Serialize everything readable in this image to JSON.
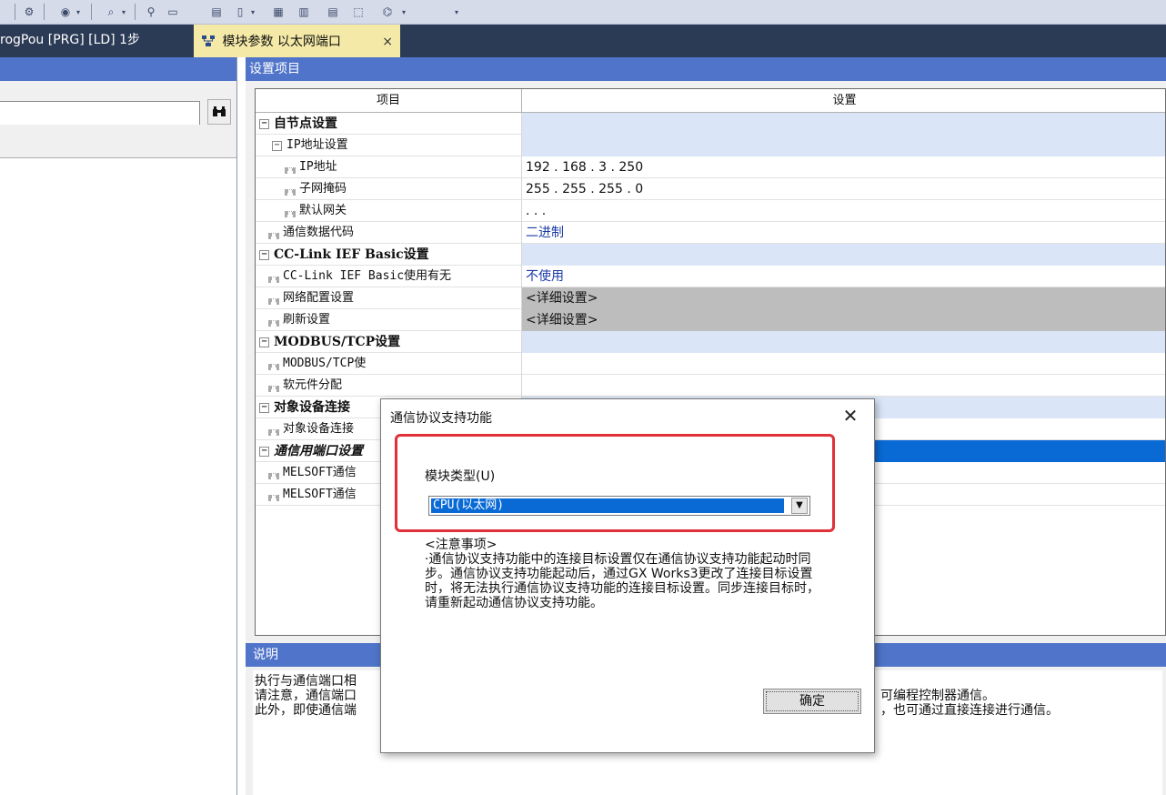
{
  "tabs": {
    "inactive_label": "rogPou [PRG] [LD] 1步",
    "active_label": "模块参数 以太网端口",
    "close_glyph": "×"
  },
  "toolbar": {
    "icons": [
      "wrench-icon",
      "eye-icon",
      "find-icon",
      "zoom-icon",
      "layout-icon",
      "page-icon",
      "grid-icon",
      "compare-icon"
    ]
  },
  "left": {
    "find_glyph": "🔍"
  },
  "settings": {
    "section_title": "设置项目",
    "col_item": "项目",
    "col_setting": "设置",
    "rows": [
      {
        "label": "自节点设置",
        "value": "",
        "type": "sect"
      },
      {
        "label": "IP地址设置",
        "value": "",
        "type": "sub"
      },
      {
        "label": "IP地址",
        "value": "192 . 168 .    3 . 250",
        "type": "leaf"
      },
      {
        "label": "子网掩码",
        "value": "255 . 255 . 255 .    0",
        "type": "leaf"
      },
      {
        "label": "默认网关",
        "value": "      .       .       .",
        "type": "leaf"
      },
      {
        "label": "通信数据代码",
        "value": "二进制",
        "type": "leaf1"
      },
      {
        "label": "CC-Link IEF Basic设置",
        "value": "",
        "type": "sect"
      },
      {
        "label": "CC-Link IEF Basic使用有无",
        "value": "不使用",
        "type": "leaf1"
      },
      {
        "label": "网络配置设置",
        "value": "<详细设置>",
        "type": "leaf1g"
      },
      {
        "label": "刷新设置",
        "value": "<详细设置>",
        "type": "leaf1g"
      },
      {
        "label": "MODBUS/TCP设置",
        "value": "",
        "type": "sect"
      },
      {
        "label": "MODBUS/TCP使",
        "value": "",
        "type": "leaf1"
      },
      {
        "label": "软元件分配",
        "value": "",
        "type": "leaf1"
      },
      {
        "label": "对象设备连接",
        "value": "",
        "type": "sect"
      },
      {
        "label": "对象设备连接",
        "value": "",
        "type": "leaf1"
      },
      {
        "label": "通信用端口设置",
        "value": "",
        "type": "sectsel"
      },
      {
        "label": "MELSOFT通信",
        "value": "",
        "type": "leaf1"
      },
      {
        "label": "MELSOFT通信",
        "value": "",
        "type": "leaf1"
      }
    ]
  },
  "description": {
    "title": "说明",
    "lines": [
      "执行与通信端口相",
      "请注意，通信端口",
      "此外，即使通信端"
    ],
    "right_lines": [
      "可编程控制器通信。",
      "，也可通过直接连接进行通信。"
    ]
  },
  "dialog": {
    "title": "通信协议支持功能",
    "close_glyph": "✕",
    "field_label": "模块类型(U)",
    "combo_value": "CPU(以太网)",
    "notes_title": "<注意事项>",
    "notes_body": "·通信协议支持功能中的连接目标设置仅在通信协议支持功能起动时同步。通信协议支持功能起动后，通过GX Works3更改了连接目标设置时，将无法执行通信协议支持功能的连接目标设置。同步连接目标时，请重新起动通信协议支持功能。",
    "ok_label": "确定"
  }
}
